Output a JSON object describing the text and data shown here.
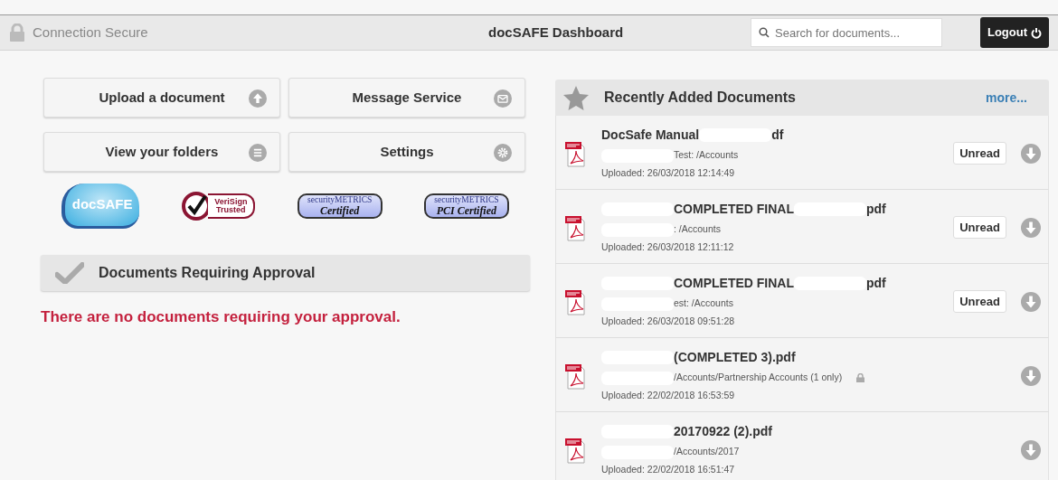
{
  "topbar": {
    "security": "Connection Secure",
    "title": "docSAFE Dashboard",
    "search": {
      "placeholder": "Search for documents..."
    },
    "logout": "Logout"
  },
  "actions": [
    {
      "label": "Upload a document",
      "kind": "upload"
    },
    {
      "label": "Message Service",
      "kind": "message"
    },
    {
      "label": "View your folders",
      "kind": "folders"
    },
    {
      "label": "Settings",
      "kind": "settings"
    }
  ],
  "logos": [
    {
      "kind": "docsafe",
      "text": "docSAFE"
    },
    {
      "kind": "verisign",
      "text": "VeriSign Trusted"
    },
    {
      "kind": "metrics",
      "brand": "securityMETRICS",
      "text": "Certified"
    },
    {
      "kind": "metrics",
      "brand": "securityMETRICS",
      "text": "PCI Certified"
    }
  ],
  "approval": {
    "title": "Documents Requiring Approval",
    "message": "There are no documents requiring your approval."
  },
  "recent": {
    "title": "Recently Added Documents",
    "more": "more...",
    "documents": [
      {
        "title": [
          {
            "kind": "text",
            "text": "DocSafe Manual"
          },
          {
            "kind": "redacted"
          },
          {
            "kind": "text",
            "text": "df"
          }
        ],
        "path": [
          {
            "kind": "redacted"
          },
          {
            "kind": "text",
            "text": "Test: /Accounts"
          }
        ],
        "uploaded": "Uploaded: 26/03/2018 12:14:49",
        "status": "Unread",
        "locked": false
      },
      {
        "title": [
          {
            "kind": "redacted"
          },
          {
            "kind": "text",
            "text": "COMPLETED FINAL"
          },
          {
            "kind": "redacted"
          },
          {
            "kind": "text",
            "text": "pdf"
          }
        ],
        "path": [
          {
            "kind": "redacted"
          },
          {
            "kind": "text",
            "text": ": /Accounts"
          }
        ],
        "uploaded": "Uploaded: 26/03/2018 12:11:12",
        "status": "Unread",
        "locked": false
      },
      {
        "title": [
          {
            "kind": "redacted"
          },
          {
            "kind": "text",
            "text": "COMPLETED FINAL"
          },
          {
            "kind": "redacted"
          },
          {
            "kind": "text",
            "text": "pdf"
          }
        ],
        "path": [
          {
            "kind": "redacted"
          },
          {
            "kind": "text",
            "text": "est: /Accounts"
          }
        ],
        "uploaded": "Uploaded: 26/03/2018 09:51:28",
        "status": "Unread",
        "locked": false
      },
      {
        "title": [
          {
            "kind": "redacted"
          },
          {
            "kind": "text",
            "text": "(COMPLETED 3).pdf"
          }
        ],
        "path": [
          {
            "kind": "redacted"
          },
          {
            "kind": "text",
            "text": "/Accounts/Partnership Accounts (1 only)"
          }
        ],
        "uploaded": "Uploaded: 22/02/2018 16:53:59",
        "locked": true
      },
      {
        "title": [
          {
            "kind": "redacted"
          },
          {
            "kind": "text",
            "text": "20170922 (2).pdf"
          }
        ],
        "path": [
          {
            "kind": "redacted"
          },
          {
            "kind": "text",
            "text": "/Accounts/2017"
          }
        ],
        "uploaded": "Uploaded: 22/02/2018 16:51:47",
        "locked": false
      }
    ]
  }
}
